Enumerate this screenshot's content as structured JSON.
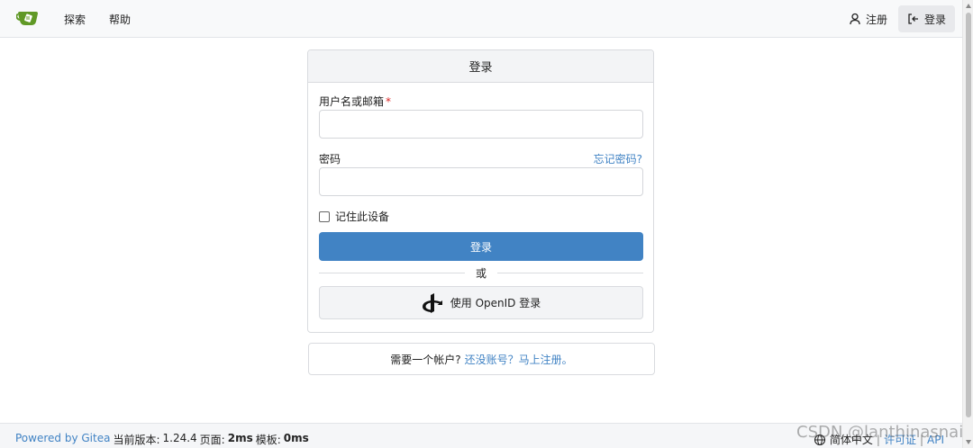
{
  "nav": {
    "explore": "探索",
    "help": "帮助",
    "register": "注册",
    "login": "登录"
  },
  "login_form": {
    "title": "登录",
    "username_label": "用户名或邮箱",
    "required_mark": "*",
    "username_value": "",
    "password_label": "密码",
    "password_value": "",
    "forgot_link": "忘记密码?",
    "remember_label": "记住此设备",
    "remember_checked": false,
    "submit_label": "登录",
    "divider_text": "或",
    "openid_label": "使用 OpenID 登录"
  },
  "register_prompt": {
    "text": "需要一个帐户?",
    "link": "还没账号？马上注册。"
  },
  "footer": {
    "powered_by": "Powered by Gitea",
    "version_label": "当前版本:",
    "version": "1.24.4",
    "page_label": "页面:",
    "page_time": "2ms",
    "template_label": "模板:",
    "template_time": "0ms",
    "language": "简体中文",
    "license": "许可证",
    "api": "API"
  },
  "watermark": "CSDN @lanthinasnail",
  "colors": {
    "accent": "#4183c4",
    "logo_green": "#609926",
    "required": "#db2828"
  }
}
